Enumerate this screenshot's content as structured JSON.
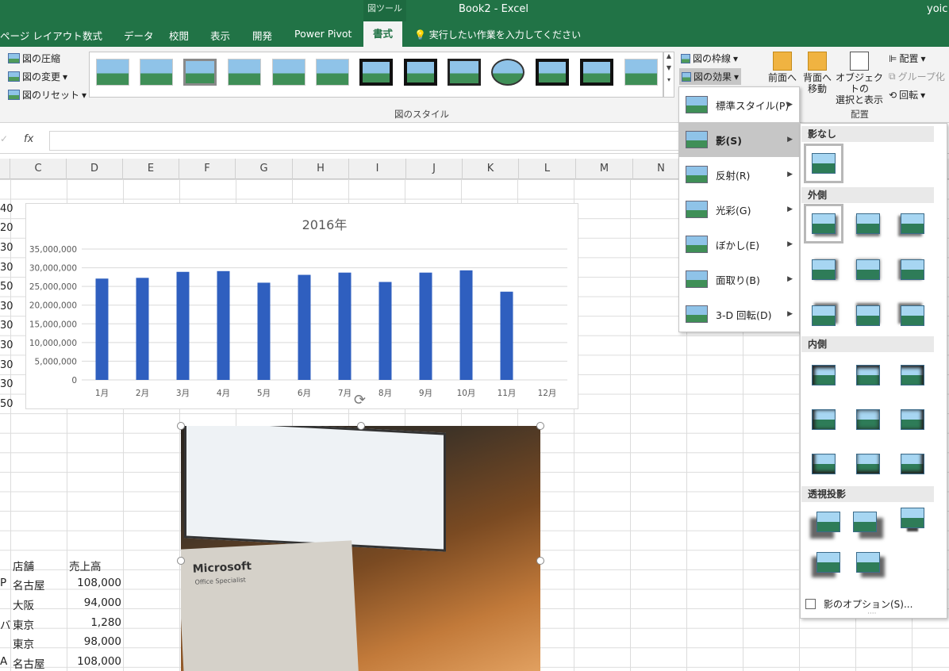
{
  "titlebar": {
    "context": "図ツール",
    "title": "Book2  -  Excel",
    "user": "yoic"
  },
  "tabs": {
    "page_layout": "ページ レイアウト",
    "formulas": "数式",
    "data": "データ",
    "review": "校閲",
    "view": "表示",
    "developer": "開発",
    "power_pivot": "Power Pivot",
    "format": "書式",
    "tellme": "実行したい作業を入力してください"
  },
  "ribbon": {
    "compress": "図の圧縮",
    "change": "図の変更",
    "reset": "図のリセット",
    "styles_label": "図のスタイル",
    "border": "図の枠線",
    "effects": "図の効果",
    "bring_forward": "前面へ",
    "send_backward": "背面へ",
    "send_backward2": "移動",
    "selection": "オブジェクトの",
    "selection2": "選択と表示",
    "align": "配置",
    "group": "グループ化",
    "rotate": "回転",
    "arrange_label": "配置"
  },
  "formula": {
    "fx": "fx",
    "check": "✓"
  },
  "columns": [
    "C",
    "D",
    "E",
    "F",
    "G",
    "H",
    "I",
    "J",
    "K",
    "L",
    "M",
    "N"
  ],
  "row_frags": [
    "40",
    "20",
    "30",
    "30",
    "50",
    "30",
    "30",
    "30",
    "30",
    "30",
    "50",
    "30"
  ],
  "table": {
    "header": [
      "店舗",
      "売上高"
    ],
    "prefix": [
      "P",
      "",
      "バ",
      "",
      "A"
    ],
    "rows": [
      [
        "名古屋",
        "108,000"
      ],
      [
        "大阪",
        "94,000"
      ],
      [
        "東京",
        "1,280"
      ],
      [
        "東京",
        "98,000"
      ],
      [
        "名古屋",
        "108,000"
      ]
    ]
  },
  "chart_data": {
    "type": "bar",
    "title": "2016年",
    "categories": [
      "1月",
      "2月",
      "3月",
      "4月",
      "5月",
      "6月",
      "7月",
      "8月",
      "9月",
      "10月",
      "11月",
      "12月"
    ],
    "values": [
      27100000,
      27300000,
      28900000,
      29100000,
      26000000,
      28100000,
      28700000,
      26200000,
      28700000,
      29300000,
      23600000,
      null
    ],
    "ylim": [
      0,
      35000000
    ],
    "yticks": [
      "35,000,000",
      "30,000,000",
      "25,000,000",
      "20,000,000",
      "15,000,000",
      "10,000,000",
      "5,000,000",
      "0"
    ],
    "color": "#2f5fbf",
    "grid": true
  },
  "photo": {
    "brand": "Microsoft",
    "brand_sub": "Office Specialist"
  },
  "effects_menu": {
    "items": [
      "標準スタイル(P)",
      "影(S)",
      "反射(R)",
      "光彩(G)",
      "ぼかし(E)",
      "面取り(B)",
      "3-D 回転(D)"
    ],
    "selected": 1
  },
  "shadow_gallery": {
    "no_shadow": "影なし",
    "outer": "外側",
    "inner": "内側",
    "perspective": "透視投影",
    "options": "影のオプション(S)..."
  }
}
